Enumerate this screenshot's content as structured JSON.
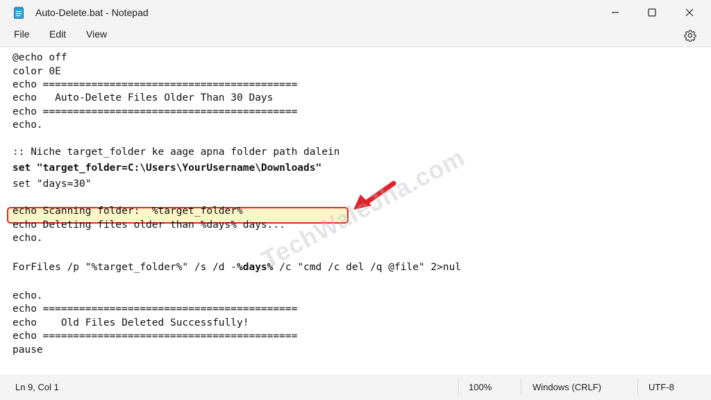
{
  "window": {
    "title": "Auto-Delete.bat - Notepad"
  },
  "menu": [
    "File",
    "Edit",
    "View"
  ],
  "editor": {
    "lines": [
      "@echo off",
      "color 0E",
      "echo ==========================================",
      "echo   Auto-Delete Files Older Than 30 Days",
      "echo ==========================================",
      "echo.",
      "",
      ":: Niche target_folder ke aage apna folder path dalein",
      "set \"target_folder=C:\\Users\\YourUsername\\Downloads\"",
      "set \"days=30\"",
      "",
      "echo Scanning folder:  %target_folder%",
      "echo Deleting files older than %days% days...",
      "echo.",
      "",
      "ForFiles /p \"%target_folder%\" /s /d -%days% /c \"cmd /c del /q @file\" 2>nul",
      "",
      "echo.",
      "echo ==========================================",
      "echo    Old Files Deleted Successfully!",
      "echo ==========================================",
      "pause"
    ],
    "line_forfiles": {
      "before": "ForFiles /p \"%target_folder%\" /s /d -",
      "bold": "%days%",
      "after": " /c \"cmd /c del /q @file\" 2>nul"
    }
  },
  "watermark": "TechWaleJha.com",
  "status": {
    "position": "Ln 9, Col 1",
    "zoom": "100%",
    "line_ending": "Windows (CRLF)",
    "encoding": "UTF-8"
  },
  "colors": {
    "highlight_border": "#e0242b",
    "highlight_fill": "#fff6c8",
    "arrow": "#e0242b"
  },
  "icons": [
    "notepad-icon",
    "minimize-icon",
    "maximize-icon",
    "close-icon",
    "settings-gear-icon",
    "red-arrow-icon"
  ]
}
